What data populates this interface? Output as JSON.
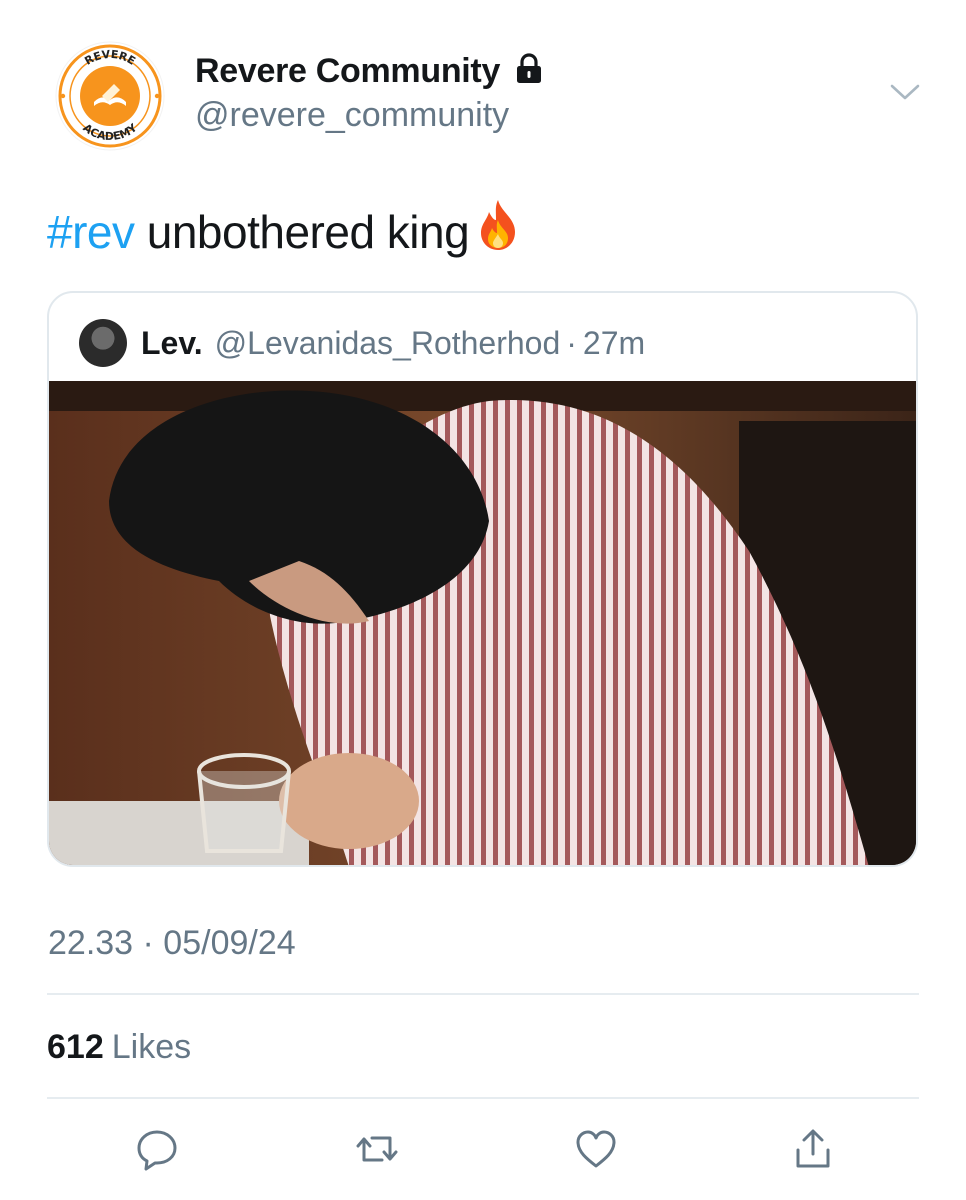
{
  "author": {
    "display_name": "Revere Community",
    "handle": "@revere_community",
    "avatar_icon": "revere-academy-logo",
    "avatar_logo_text_top": "REVERE",
    "avatar_logo_text_bottom": "ACADEMY",
    "protected_icon": "lock-icon"
  },
  "tweet": {
    "hashtag": "#rev",
    "text": " unbothered king",
    "emoji": "fire-icon",
    "timestamp": "22.33 · 05/09/24"
  },
  "quoted": {
    "name": "Lev.",
    "handle": "@Levanidas_Rotherhod",
    "separator": "·",
    "time": "27m",
    "media": "photo of a person in a red-striped shirt leaning over a glass"
  },
  "stats": {
    "likes_count": "612",
    "likes_label": "Likes"
  },
  "actions": [
    "reply-icon",
    "retweet-icon",
    "like-icon",
    "share-icon"
  ],
  "colors": {
    "link": "#1da1f2",
    "secondary_text": "#657786",
    "primary_text": "#14171a",
    "divider": "#e6ecf0",
    "logo_orange": "#f7941d"
  }
}
